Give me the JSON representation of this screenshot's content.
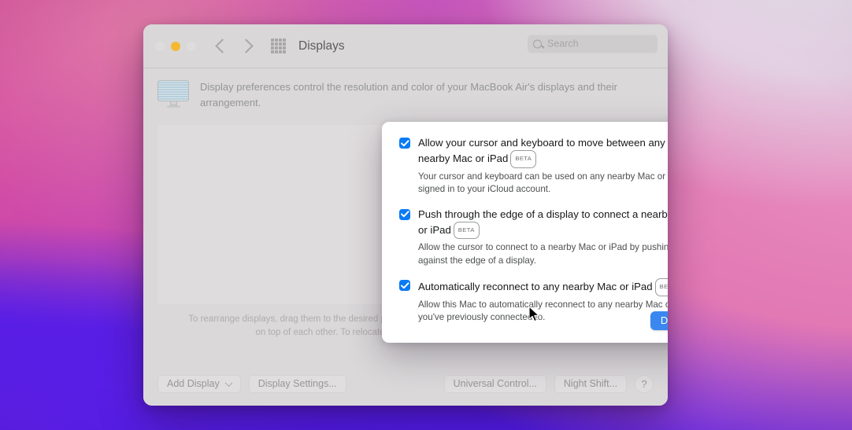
{
  "window": {
    "title": "Displays",
    "traffic_lights": [
      "close-red",
      "minimize-amber",
      "zoom-green"
    ],
    "nav": {
      "back": "back-chevron",
      "forward": "forward-chevron",
      "grid": "show-all-grid"
    },
    "search": {
      "placeholder": "Search",
      "value": ""
    }
  },
  "main": {
    "description": "Display preferences control the resolution and color of your MacBook Air's displays and their arrangement.",
    "hint": "To rearrange displays, drag them to the desired position. To mirror displays, hold Option while dragging them on top of each other. To relocate the menu bar, drag it to a different display.",
    "buttons": {
      "add_display": "Add Display",
      "display_settings": "Display Settings...",
      "universal_control": "Universal Control...",
      "night_shift": "Night Shift...",
      "help": "?"
    }
  },
  "sheet": {
    "options": [
      {
        "checked": true,
        "title": "Allow your cursor and keyboard to move between any nearby Mac or iPad",
        "badge": "BETA",
        "subtitle": "Your cursor and keyboard can be used on any nearby Mac or iPad signed in to your iCloud account."
      },
      {
        "checked": true,
        "title": "Push through the edge of a display to connect a nearby Mac or iPad",
        "badge": "BETA",
        "subtitle": "Allow the cursor to connect to a nearby Mac or iPad by pushing against the edge of a display."
      },
      {
        "checked": true,
        "title": "Automatically reconnect to any nearby Mac or iPad",
        "badge": "BETA",
        "subtitle": "Allow this Mac to automatically reconnect to any nearby Mac or iPad you've previously connected to."
      }
    ],
    "done_label": "Done"
  },
  "colors": {
    "accent_blue": "#0a7bf5",
    "done_button": "#3b87f0",
    "window_bg": "#d4d2d3",
    "sheet_bg": "#ffffff",
    "amber_light": "#f3b935"
  }
}
